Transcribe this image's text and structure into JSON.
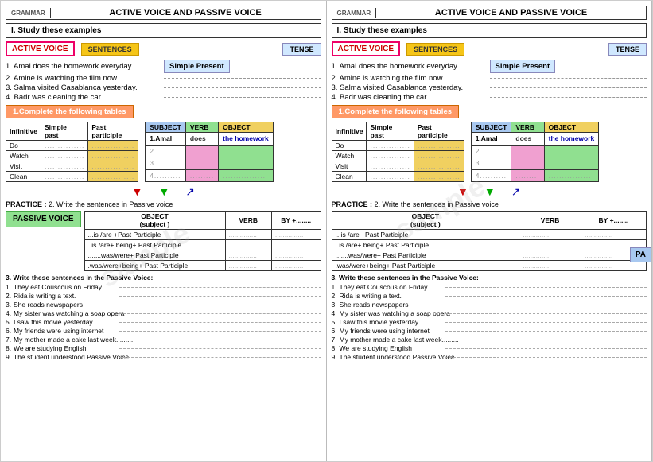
{
  "panels": [
    {
      "id": "left",
      "grammar_label": "GRAMMAR",
      "title": "ACTIVE VOICE AND PASSIVE VOICE",
      "study_heading": "I. Study these examples",
      "active_voice_label": "ACTIVE VOICE",
      "sentences_label": "SENTENCES",
      "tense_label": "TENSE",
      "sentences": [
        "1. Amal does the homework everyday.",
        "2. Amine is watching the film now",
        "3. Salma visited Casablanca yesterday.",
        "4. Badr  was cleaning the car ."
      ],
      "simple_present": "Simple Present",
      "complete_label": "1.Complete the following tables",
      "inf_table": {
        "headers": [
          "Infinitive",
          "Simple\npast",
          "Past\nparticiple"
        ],
        "rows": [
          {
            "inf": "Do",
            "sp": "...............",
            "pp": "................"
          },
          {
            "inf": "Watch",
            "sp": "...............",
            "pp": "................"
          },
          {
            "inf": "Visit",
            "sp": "...............",
            "pp": "................"
          },
          {
            "inf": "Clean",
            "sp": "...............",
            "pp": "................"
          }
        ]
      },
      "svo_table": {
        "headers": [
          "SUBJECT",
          "VERB",
          "OBJECT"
        ],
        "rows": [
          {
            "s": "1.Amal",
            "v": "does",
            "o": "the homework"
          },
          {
            "s": "2..........",
            "v": ".........",
            "o": "................"
          },
          {
            "s": "3..........",
            "v": ".........",
            "o": "................"
          },
          {
            "s": "4..........",
            "v": ".........",
            "o": "................"
          }
        ]
      },
      "practice_label": "PRACTICE :",
      "practice_text": "2. Write the sentences in Passive voice",
      "passive_voice_label": "PASSIVE VOICE",
      "passive_table": {
        "headers": [
          "OBJECT\n(subject )",
          "VERB",
          "BY +........"
        ],
        "rows": [
          {
            "form": "...is /are +Past Participle",
            "obj": "...............",
            "verb": "...............",
            "by": ""
          },
          {
            "form": "..is /are+ being+  Past Participle",
            "obj": "...............",
            "verb": "...............",
            "by": ""
          },
          {
            "form": ".......was/were+ Past Participle",
            "obj": "...............",
            "verb": "...............",
            "by": ""
          },
          {
            "form": ".was/were+being+ Past Participle",
            "obj": "...............",
            "verb": "...............",
            "by": ""
          }
        ]
      },
      "write_heading": "3. Write these sentences in the Passive Voice:",
      "write_sentences": [
        {
          "num": "1.",
          "text": "They eat Couscous on Friday"
        },
        {
          "num": "2.",
          "text": "Rida is writing a text."
        },
        {
          "num": "3.",
          "text": "She reads newspapers"
        },
        {
          "num": "4.",
          "text": "My sister was watching a soap opera"
        },
        {
          "num": "5.",
          "text": "I saw this movie yesterday"
        },
        {
          "num": "6.",
          "text": "My friends were using internet"
        },
        {
          "num": "7.",
          "text": "My mother made a cake last week........."
        },
        {
          "num": "8.",
          "text": "We are studying English"
        },
        {
          "num": "9.",
          "text": "The student understood Passive Voice........."
        }
      ]
    },
    {
      "id": "right",
      "grammar_label": "GRAMMAR",
      "title": "ACTIVE VOICE AND PASSIVE VOICE",
      "study_heading": "I. Study these examples",
      "active_voice_label": "ACTIVE VOICE",
      "sentences_label": "SENTENCES",
      "tense_label": "TENSE",
      "sentences": [
        "1. Amal does the homework everyday.",
        "2. Amine is watching the film now",
        "3. Salma visited Casablanca yesterday.",
        "4. Badr  was cleaning the car ."
      ],
      "simple_present": "Simple Present",
      "complete_label": "1.Complete the following tables",
      "inf_table": {
        "headers": [
          "Infinitive",
          "Simple\npast",
          "Past\nparticiple"
        ],
        "rows": [
          {
            "inf": "Do",
            "sp": "...............",
            "pp": "................"
          },
          {
            "inf": "Watch",
            "sp": "...............",
            "pp": "................"
          },
          {
            "inf": "Visit",
            "sp": "...............",
            "pp": "................"
          },
          {
            "inf": "Clean",
            "sp": "...............",
            "pp": "................"
          }
        ]
      },
      "svo_table": {
        "headers": [
          "SUBJECT",
          "VERB",
          "OBJECT"
        ],
        "rows": [
          {
            "s": "1.Amal",
            "v": "does",
            "o": "the homework"
          },
          {
            "s": "2..........",
            "v": ".........",
            "o": "................"
          },
          {
            "s": "3..........",
            "v": ".........",
            "o": "................"
          },
          {
            "s": "4..........",
            "v": ".........",
            "o": "................"
          }
        ]
      },
      "practice_label": "PRACTICE :",
      "practice_text": "2. Write the sentences in Passive voice",
      "passive_voice_label": "PASSIVE VOICE",
      "passive_table": {
        "headers": [
          "OBJECT\n(subject )",
          "VERB",
          "BY +........"
        ],
        "rows": [
          {
            "form": "...is /are +Past Participle",
            "obj": "...............",
            "verb": "...............",
            "by": ""
          },
          {
            "form": "..is /are+ being+  Past Participle",
            "obj": "...............",
            "verb": "...............",
            "by": ""
          },
          {
            "form": ".......was/were+ Past Participle",
            "obj": "...............",
            "verb": "...............",
            "by": ""
          },
          {
            "form": ".was/were+being+ Past Participle",
            "obj": "...............",
            "verb": "...............",
            "by": ""
          }
        ]
      },
      "write_heading": "3. Write these sentences in the Passive Voice:",
      "write_sentences": [
        {
          "num": "1.",
          "text": "They eat Couscous on Friday"
        },
        {
          "num": "2.",
          "text": "Rida is writing a text."
        },
        {
          "num": "3.",
          "text": "She reads newspapers"
        },
        {
          "num": "4.",
          "text": "My sister was watching a soap opera"
        },
        {
          "num": "5.",
          "text": "I saw this movie yesterday"
        },
        {
          "num": "6.",
          "text": "My friends were using internet"
        },
        {
          "num": "7.",
          "text": "My mother made a cake last week........."
        },
        {
          "num": "8.",
          "text": "We are studying English"
        },
        {
          "num": "9.",
          "text": "The student understood Passive Voice........."
        }
      ]
    }
  ]
}
